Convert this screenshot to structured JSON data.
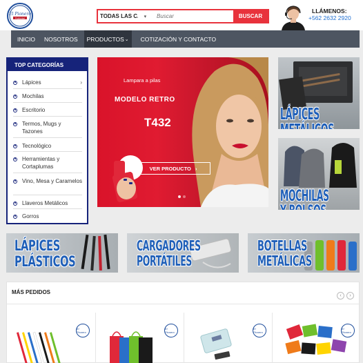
{
  "logo": {
    "name": "El Pionero",
    "subtitle": "Publicidad"
  },
  "search": {
    "category": "TODAS LAS CAT",
    "placeholder": "Buscar",
    "button": "BUSCAR"
  },
  "contact": {
    "title": "LLÁMENOS:",
    "phone": "+562 2632 2920"
  },
  "nav": {
    "items": [
      "INICIO",
      "NOSOTROS",
      "PRODUCTOS",
      "COTIZACIÓN Y CONTACTO"
    ]
  },
  "sidebar": {
    "title": "TOP CATEGORÍAS",
    "items": [
      {
        "label": "Lápices",
        "has_arrow": true
      },
      {
        "label": "Mochilas"
      },
      {
        "label": "Escritorio"
      },
      {
        "label": "Termos, Mugs y Tazones"
      },
      {
        "label": "Tecnológico"
      },
      {
        "label": "Herramientas y Cortaplumas"
      },
      {
        "label": "Vino, Mesa y Caramelos"
      },
      {
        "label": "Llaveros Metálicos"
      },
      {
        "label": "Gorros"
      }
    ]
  },
  "banner": {
    "line1": "Lampara a pilas",
    "line2": "MODELO RETRO",
    "line3": "T432",
    "button": "VER PRODUCTO",
    "button_arrow": "›",
    "slides": 2,
    "active_slide": 1
  },
  "tiles": {
    "lapices_metalicos": "LÁPICES METÁLICOS",
    "mochilas_bolsos": "MOCHILAS Y BOLSOS",
    "lapices_plasticos_1": "LÁPICES",
    "lapices_plasticos_2": "PLÁSTICOS",
    "cargadores_1": "CARGADORES",
    "cargadores_2": "PORTÁTILES",
    "botellas_1": "BOTELLAS",
    "botellas_2": "METÁLICAS"
  },
  "section": {
    "title": "MÁS PEDIDOS",
    "prev": "‹",
    "next": "›"
  },
  "colors": {
    "accent_red": "#e8323c",
    "nav_gray": "#4d5561",
    "sidebar_blue": "#16237a",
    "tile_blue": "#1f5fb8",
    "phone_blue": "#1f6fd1"
  },
  "icons": [
    "phone-agent-icon",
    "chevron-down-icon",
    "chevron-right-icon",
    "bullet-icon"
  ]
}
